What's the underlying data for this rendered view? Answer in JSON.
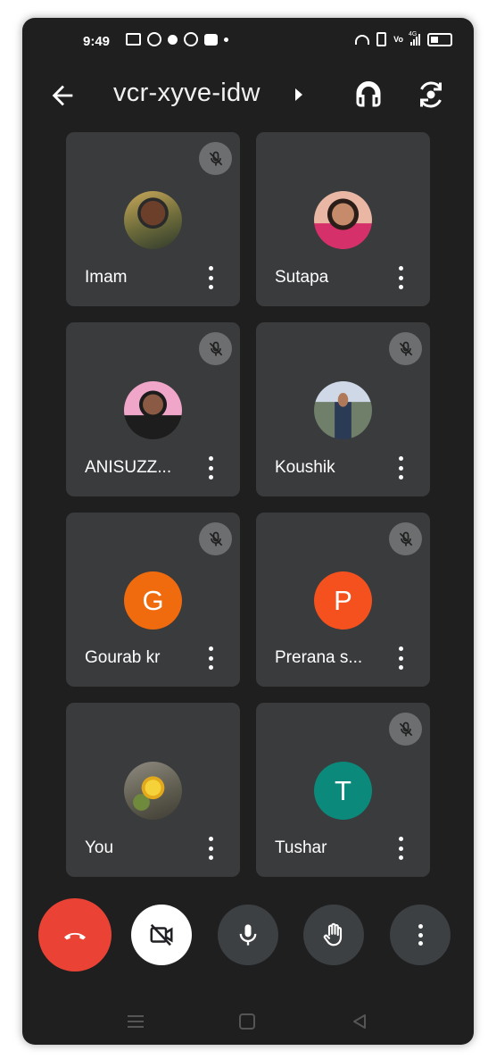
{
  "status_bar": {
    "time": "9:49",
    "network": "4G"
  },
  "header": {
    "meeting_code": "vcr-xyve-idw"
  },
  "participants": [
    {
      "name": "Imam",
      "avatar_type": "photo",
      "muted": true
    },
    {
      "name": "Sutapa",
      "avatar_type": "photo",
      "muted": false
    },
    {
      "name": "ANISUZZ...",
      "avatar_type": "photo",
      "muted": true
    },
    {
      "name": "Koushik",
      "avatar_type": "photo",
      "muted": true
    },
    {
      "name": "Gourab kr",
      "avatar_type": "initial",
      "initial": "G",
      "color": "#f06a0e",
      "muted": true
    },
    {
      "name": "Prerana s...",
      "avatar_type": "initial",
      "initial": "P",
      "color": "#f4511e",
      "muted": true
    },
    {
      "name": "You",
      "avatar_type": "photo",
      "muted": false
    },
    {
      "name": "Tushar",
      "avatar_type": "initial",
      "initial": "T",
      "color": "#0b8a7b",
      "muted": true
    }
  ],
  "controls": {
    "end_call_color": "#ea4335",
    "items": [
      "end-call-icon",
      "camera-off-icon",
      "microphone-icon",
      "raise-hand-icon",
      "more-vert-icon"
    ]
  },
  "colors": {
    "background": "#1f1f1f",
    "tile": "#3a3b3d",
    "mute_badge": "#6d6e70",
    "control": "#3c4043"
  }
}
